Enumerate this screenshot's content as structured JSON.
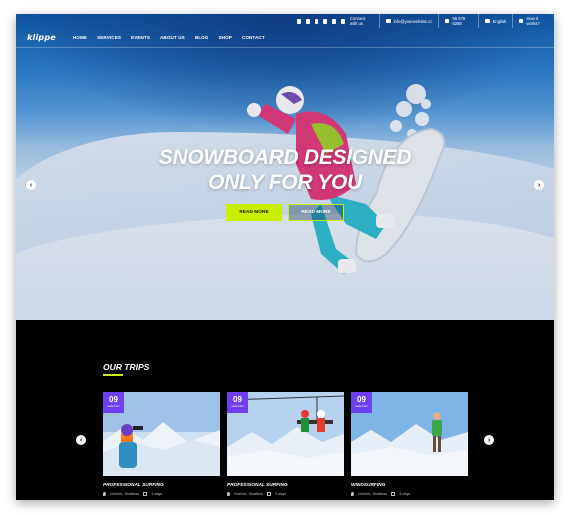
{
  "topbar": {
    "connect": "Connect with us",
    "email": "info@yourwebsite.cc",
    "phone": "55 678 6286",
    "language": "English",
    "user": "How it works?",
    "social_icons": [
      "facebook-icon",
      "twitter-icon",
      "google-plus-icon",
      "instagram-icon",
      "linkedin-icon",
      "youtube-icon"
    ]
  },
  "nav": {
    "logo": "klippe",
    "items": [
      "HOME",
      "SERVICES",
      "EVENTS",
      "ABOUT US",
      "BLOG",
      "SHOP",
      "CONTACT"
    ]
  },
  "hero": {
    "headline_line1": "SNOWBOARD DESIGNED",
    "headline_line2": "ONLY FOR YOU",
    "primary_button": "READ MORE",
    "secondary_button": "READ MORE",
    "accent": "#c8f000"
  },
  "trips": {
    "title": "OUR TRIPS",
    "cards": [
      {
        "day": "09",
        "month": "september",
        "title": "PROFESSIONAL SURFING",
        "location": "Greece, Skiathos",
        "duration": "1 days"
      },
      {
        "day": "09",
        "month": "september",
        "title": "PROFESSIONAL SURFING",
        "location": "Greece, Skiathos",
        "duration": "2 days"
      },
      {
        "day": "09",
        "month": "september",
        "title": "WINDSURFING",
        "location": "Greece, Skiathos",
        "duration": "3 days"
      }
    ],
    "badge_color": "#6d3ff0"
  }
}
